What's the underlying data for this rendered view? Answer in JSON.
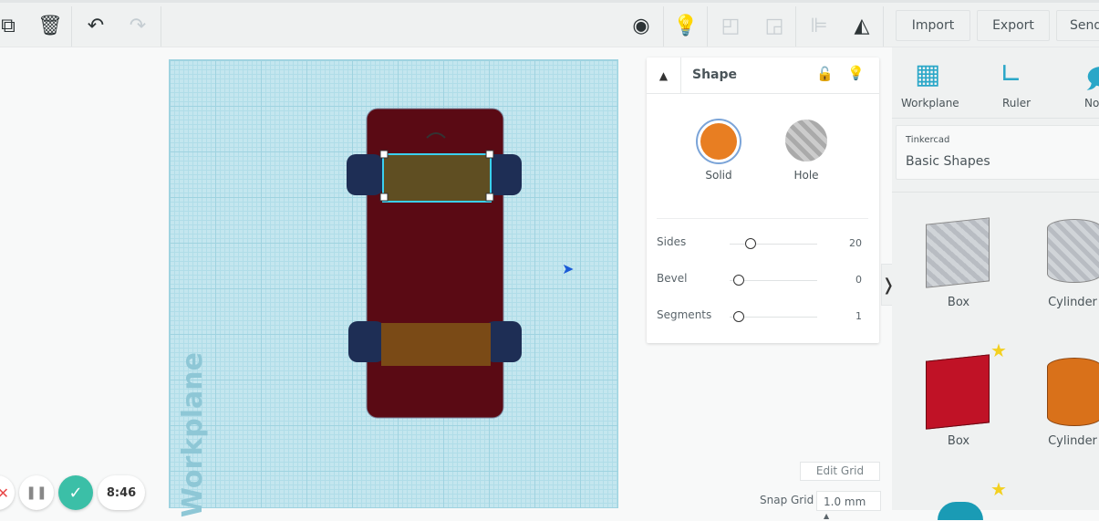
{
  "toolbar": {
    "import_label": "Import",
    "export_label": "Export",
    "send_label": "Send"
  },
  "workplane": {
    "watermark": "Workplane"
  },
  "inspector": {
    "title": "Shape",
    "solid_label": "Solid",
    "hole_label": "Hole",
    "props": [
      {
        "label": "Sides",
        "value": "20",
        "fraction": 0.12
      },
      {
        "label": "Bevel",
        "value": "0",
        "fraction": 0
      },
      {
        "label": "Segments",
        "value": "1",
        "fraction": 0
      }
    ]
  },
  "grid_controls": {
    "edit_grid_label": "Edit Grid",
    "snap_grid_label": "Snap Grid",
    "snap_grid_value": "1.0 mm"
  },
  "tools": [
    {
      "label": "Workplane"
    },
    {
      "label": "Ruler"
    },
    {
      "label": "No"
    }
  ],
  "library": {
    "source": "Tinkercad",
    "category": "Basic Shapes"
  },
  "shapes": [
    {
      "label": "Box"
    },
    {
      "label": "Cylinder"
    },
    {
      "label": "Box"
    },
    {
      "label": "Cylinder"
    }
  ],
  "timer": {
    "value": "8:46"
  },
  "colors": {
    "accent": "#e87e22",
    "car_body": "#5a0a14",
    "wheel": "#1e2e55"
  }
}
